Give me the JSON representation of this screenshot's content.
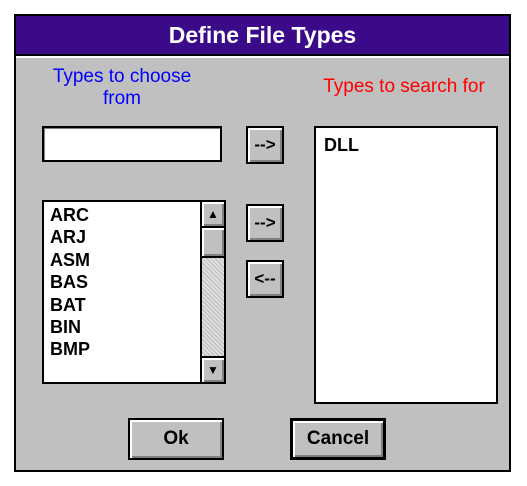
{
  "dialog": {
    "title": "Define File Types"
  },
  "source": {
    "caption": "Types to choose from",
    "input_value": "",
    "items": [
      "ARC",
      "ARJ",
      "ASM",
      "BAS",
      "BAT",
      "BIN",
      "BMP"
    ]
  },
  "target": {
    "caption": "Types to search for",
    "items": [
      "DLL"
    ]
  },
  "buttons": {
    "add_typed": "-->",
    "add_selected": "-->",
    "remove": "<--",
    "ok": "Ok",
    "cancel": "Cancel"
  },
  "scrollbar": {
    "up_icon": "arrow-up-icon",
    "down_icon": "arrow-down-icon",
    "up_glyph": "▲",
    "down_glyph": "▼"
  },
  "colors": {
    "titlebar": "#3a0a88",
    "source_caption": "#0000ff",
    "target_caption": "#ff0000",
    "dialog_bg": "#c0c0c0"
  }
}
